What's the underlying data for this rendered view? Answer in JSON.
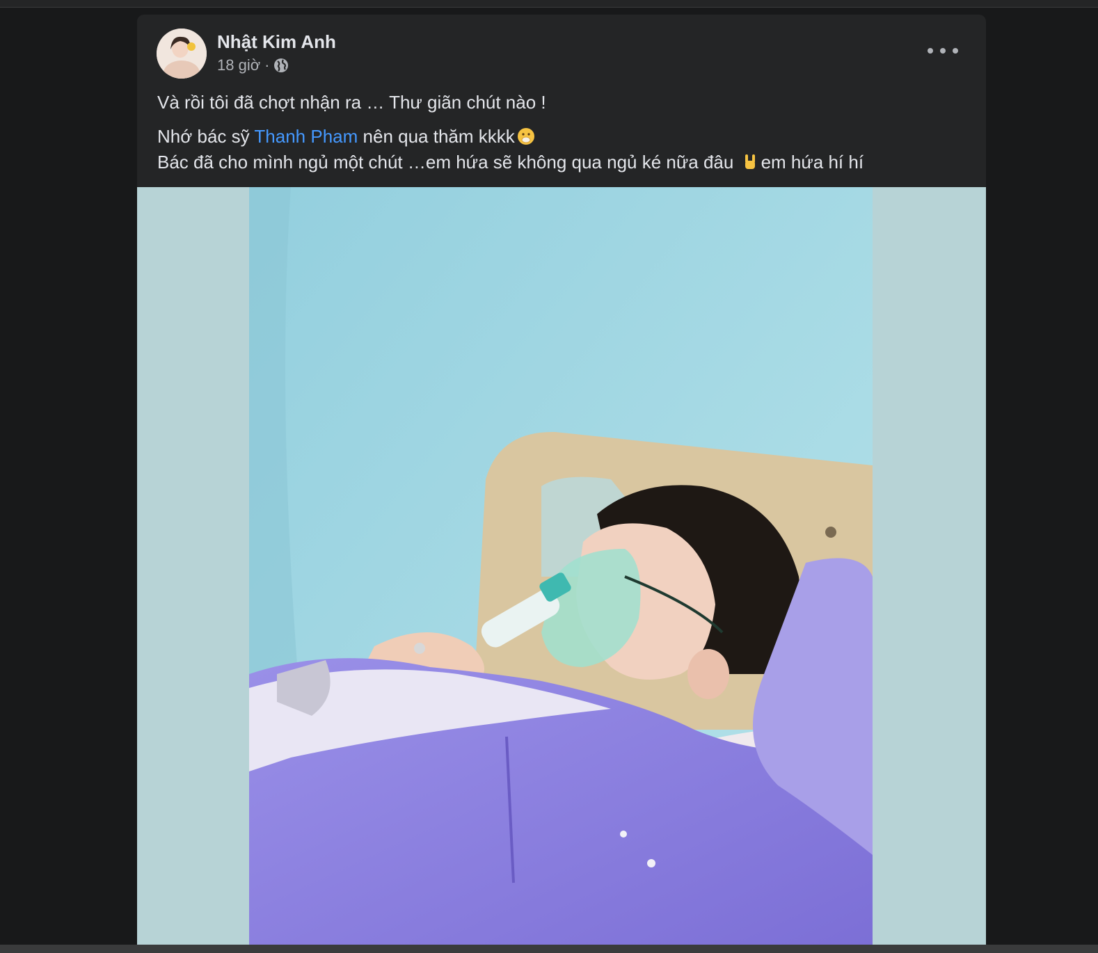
{
  "post": {
    "author": "Nhật Kim Anh",
    "time": "18 giờ",
    "separator": "·",
    "privacy_icon": "globe-icon",
    "more_icon": "more-options-icon",
    "lines": {
      "line1": "Và rồi tôi đã chợt nhận ra … Thư giãn chút nào !",
      "line2_before": "Nhớ bác sỹ ",
      "mention": "Thanh Pham",
      "line2_after": " nên qua thăm kkkk",
      "line2_emoji": "face-with-hand-over-mouth-emoji",
      "line3_before": "Bác đã cho mình ngủ một chút …em hứa sẽ không qua ngủ ké nữa đâu ",
      "line3_emoji": "rock-on-hand-emoji",
      "line3_after": "em hứa hí hí"
    },
    "photo_description_icon": "post-photo"
  },
  "colors": {
    "background": "#18191a",
    "card": "#242526",
    "text_primary": "#e4e6eb",
    "text_secondary": "#b0b3b8",
    "mention": "#4599ff"
  }
}
